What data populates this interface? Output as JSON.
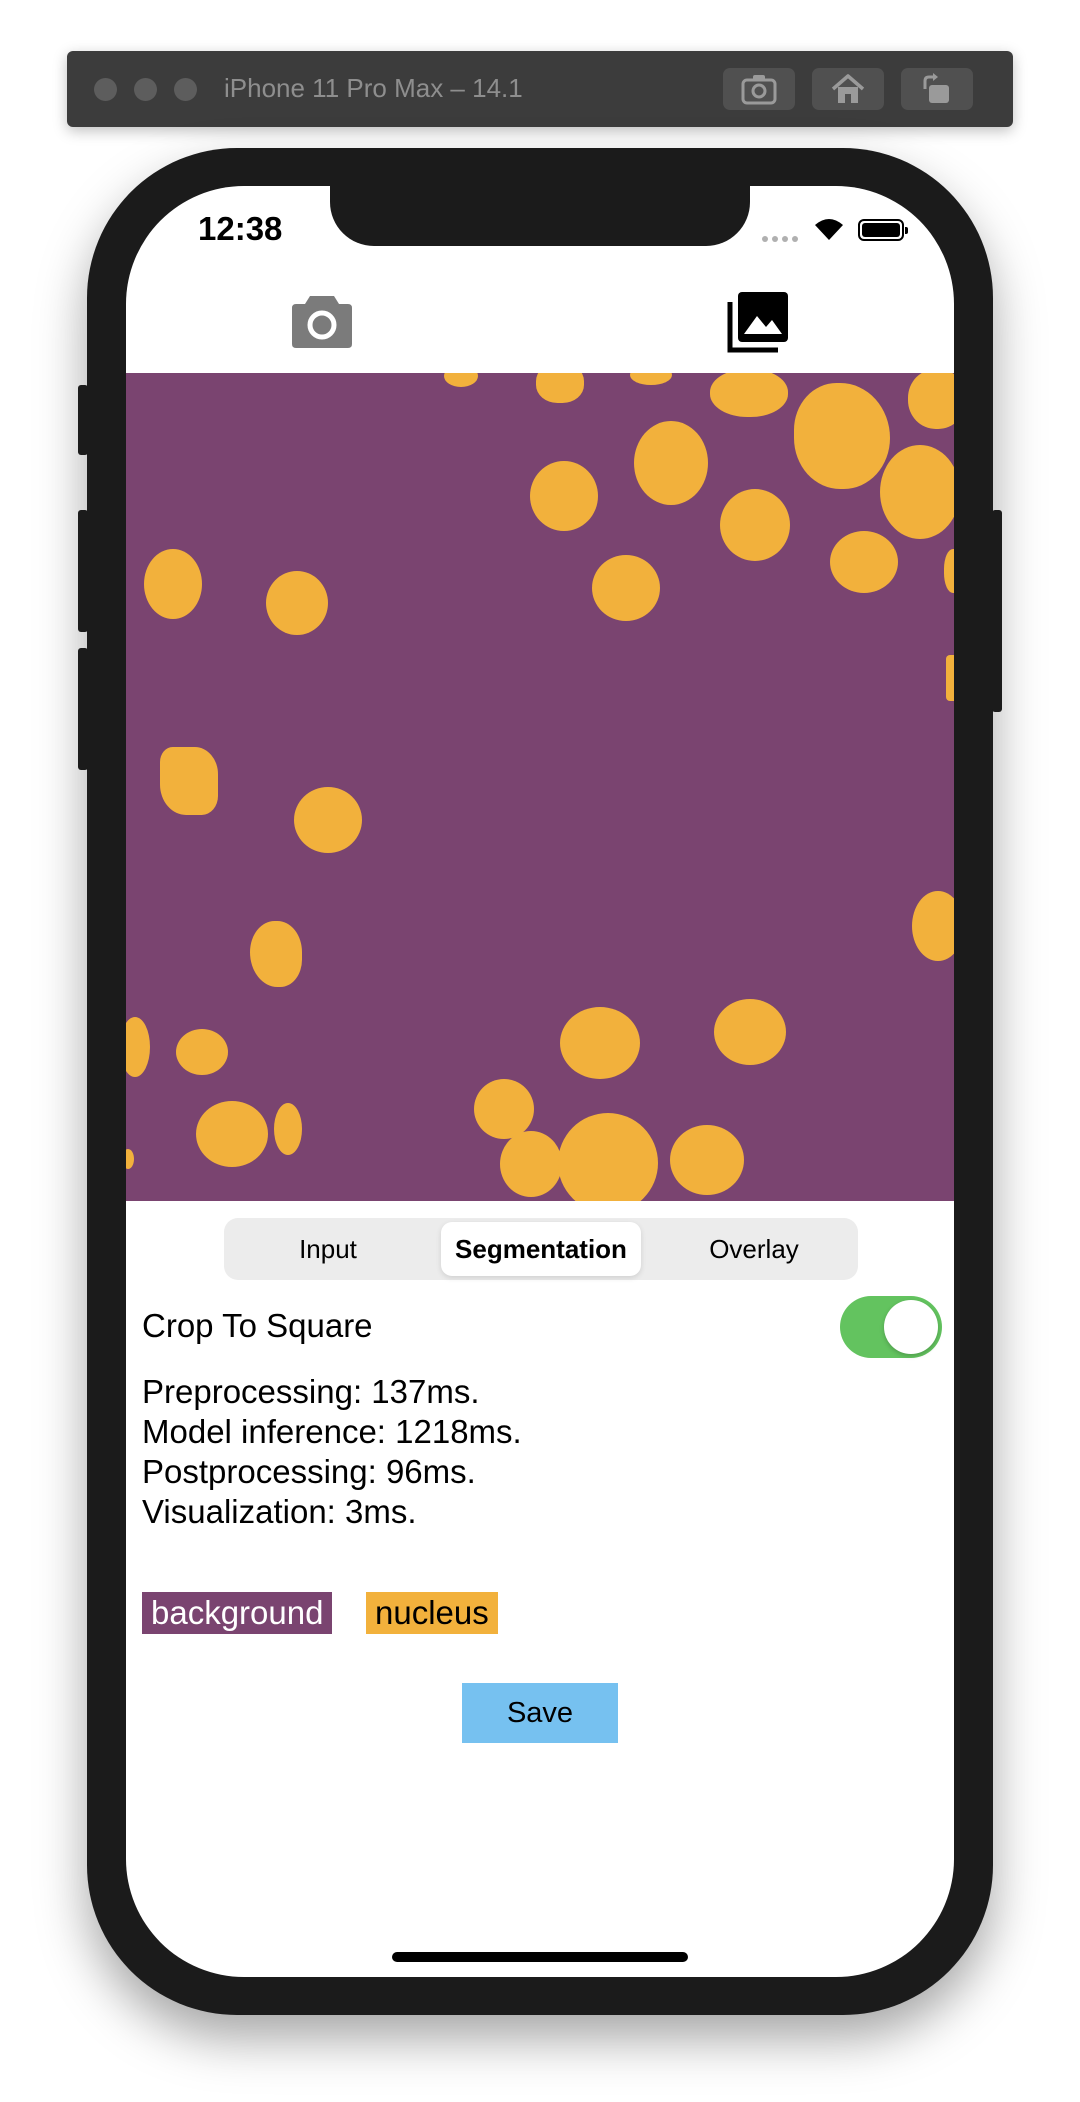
{
  "simulator": {
    "title": "iPhone 11 Pro Max – 14.1",
    "buttons": [
      "screenshot-icon",
      "home-icon",
      "rotate-icon"
    ]
  },
  "status_bar": {
    "time": "12:38"
  },
  "toolbar": {
    "left_icon": "camera-icon",
    "right_icon": "photo-library-icon"
  },
  "image": {
    "background_color": "#7a4470",
    "nucleus_color": "#f2b13c"
  },
  "segmented_control": {
    "items": [
      "Input",
      "Segmentation",
      "Overlay"
    ],
    "selected": "Segmentation"
  },
  "crop": {
    "label": "Crop To Square",
    "enabled": true
  },
  "stats": {
    "preprocessing": "Preprocessing: 137ms.",
    "inference": "Model inference: 1218ms.",
    "postprocessing": "Postprocessing: 96ms.",
    "visualization": "Visualization: 3ms."
  },
  "legend": [
    {
      "label": "background",
      "color": "#7a4470",
      "text_color": "#ffffff"
    },
    {
      "label": "nucleus",
      "color": "#f2b13c",
      "text_color": "#000000"
    }
  ],
  "save_label": "Save"
}
